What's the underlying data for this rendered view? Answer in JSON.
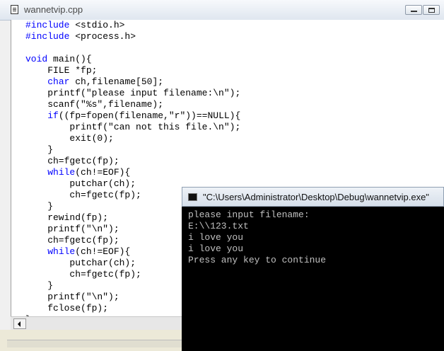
{
  "editor": {
    "title": "wannetvip.cpp",
    "code_lines": [
      [
        {
          "t": "#include",
          "k": true
        },
        {
          "t": " <stdio.h>"
        }
      ],
      [
        {
          "t": "#include",
          "k": true
        },
        {
          "t": " <process.h>"
        }
      ],
      [
        {
          "t": ""
        }
      ],
      [
        {
          "t": "void",
          "k": true
        },
        {
          "t": " main(){"
        }
      ],
      [
        {
          "t": "    FILE *fp;"
        }
      ],
      [
        {
          "t": "    "
        },
        {
          "t": "char",
          "k": true
        },
        {
          "t": " ch,filename[50];"
        }
      ],
      [
        {
          "t": "    printf(\"please input filename:\\n\");"
        }
      ],
      [
        {
          "t": "    scanf(\"%s\",filename);"
        }
      ],
      [
        {
          "t": "    "
        },
        {
          "t": "if",
          "k": true
        },
        {
          "t": "((fp=fopen(filename,\"r\"))==NULL){"
        }
      ],
      [
        {
          "t": "        printf(\"can not this file.\\n\");"
        }
      ],
      [
        {
          "t": "        exit(0);"
        }
      ],
      [
        {
          "t": "    }"
        }
      ],
      [
        {
          "t": "    ch=fgetc(fp);"
        }
      ],
      [
        {
          "t": "    "
        },
        {
          "t": "while",
          "k": true
        },
        {
          "t": "(ch!=EOF){"
        }
      ],
      [
        {
          "t": "        putchar(ch);"
        }
      ],
      [
        {
          "t": "        ch=fgetc(fp);"
        }
      ],
      [
        {
          "t": "    }"
        }
      ],
      [
        {
          "t": "    rewind(fp);"
        }
      ],
      [
        {
          "t": "    printf(\"\\n\");"
        }
      ],
      [
        {
          "t": "    ch=fgetc(fp);"
        }
      ],
      [
        {
          "t": "    "
        },
        {
          "t": "while",
          "k": true
        },
        {
          "t": "(ch!=EOF){"
        }
      ],
      [
        {
          "t": "        putchar(ch);"
        }
      ],
      [
        {
          "t": "        ch=fgetc(fp);"
        }
      ],
      [
        {
          "t": "    }"
        }
      ],
      [
        {
          "t": "    printf(\"\\n\");"
        }
      ],
      [
        {
          "t": "    fclose(fp);"
        }
      ],
      [
        {
          "t": "}"
        }
      ]
    ]
  },
  "console": {
    "title": "\"C:\\Users\\Administrator\\Desktop\\Debug\\wannetvip.exe\"",
    "lines": [
      "please input filename:",
      "E:\\\\123.txt",
      "i love you",
      "i love you",
      "Press any key to continue"
    ]
  },
  "colors": {
    "keyword": "#0000ff",
    "console_bg": "#000000",
    "console_text": "#c0c0c0"
  },
  "icons": {
    "editor": "document-icon",
    "console": "console-app-icon",
    "minimize": "minimize-icon",
    "maximize": "maximize-icon",
    "scroll_left": "scroll-left-arrow-icon"
  }
}
